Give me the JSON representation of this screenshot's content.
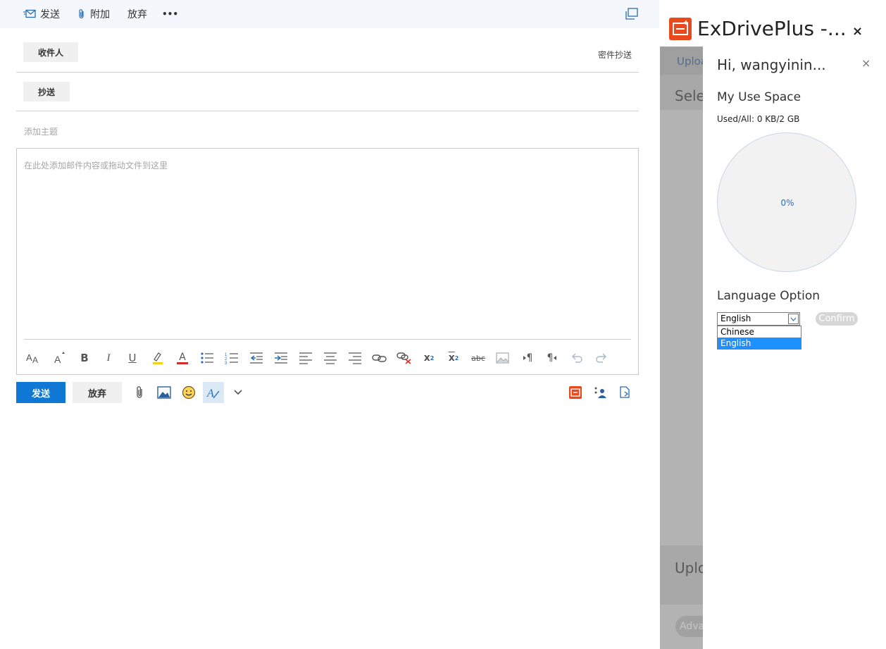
{
  "compose": {
    "toolbar": {
      "send": "发送",
      "attach": "附加",
      "discard": "放弃",
      "more": "•••"
    },
    "to_label": "收件人",
    "bcc_label": "密件抄送",
    "cc_label": "抄送",
    "subject_placeholder": "添加主题",
    "body_placeholder": "在此处添加邮件内容或拖动文件到这里",
    "send_button": "发送",
    "discard_button": "放弃",
    "format_tools": [
      "font-size-icon",
      "grow-font-icon",
      "bold-icon",
      "italic-icon",
      "underline-icon",
      "highlight-icon",
      "font-color-icon",
      "bullets-icon",
      "numbering-icon",
      "decrease-indent-icon",
      "increase-indent-icon",
      "align-left-icon",
      "align-center-icon",
      "align-right-icon",
      "insert-link-icon",
      "remove-link-icon",
      "superscript-icon",
      "subscript-icon",
      "strikethrough-icon",
      "insert-image-icon",
      "ltr-icon",
      "rtl-icon",
      "undo-icon",
      "redo-icon"
    ],
    "format_labels": {
      "bold": "B",
      "italic": "I",
      "underline": "U",
      "font_color": "A",
      "superscript": "x",
      "subscript": "x",
      "strikethrough": "abc",
      "ltr": "¶",
      "rtl": "¶"
    }
  },
  "addin": {
    "title": "ExDrivePlus -...",
    "close": "×",
    "background": {
      "tab": "Uploa",
      "select": "Sele",
      "upload": "Uplo",
      "advanced": "Adva"
    },
    "greeting": "Hi, wangyinin...",
    "card_close": "×",
    "space_title": "My Use Space",
    "usage_text": "Used/All: 0 KB/2 GB",
    "usage_percent": "0%",
    "usage_fraction": 0,
    "language_title": "Language Option",
    "language_selected": "English",
    "language_options": [
      "Chinese",
      "English"
    ],
    "confirm_button": "Confirm",
    "colors": {
      "brand": "#e8491d",
      "accent": "#0f78d4",
      "selected_option": "#1e90ff"
    }
  }
}
